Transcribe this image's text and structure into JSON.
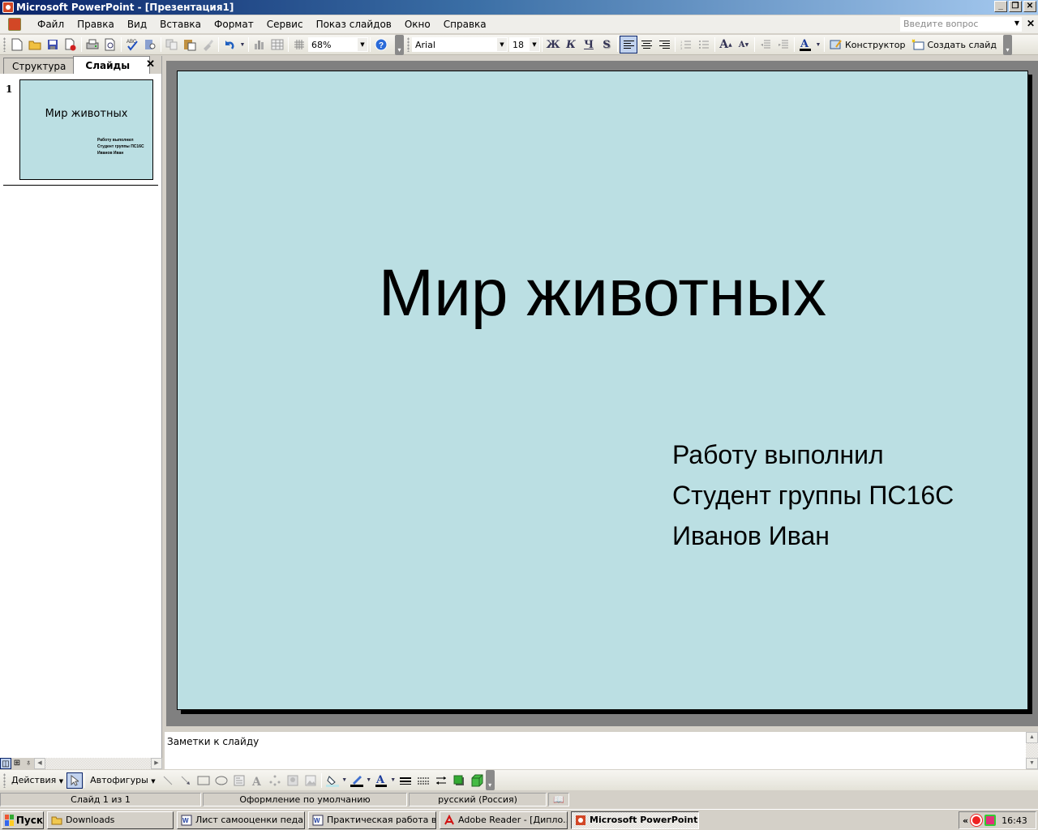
{
  "window": {
    "title": "Microsoft PowerPoint - [Презентация1]",
    "controls": {
      "minimize": "_",
      "restore": "❐",
      "close": "✕"
    }
  },
  "menu": {
    "items": [
      "Файл",
      "Правка",
      "Вид",
      "Вставка",
      "Формат",
      "Сервис",
      "Показ слайдов",
      "Окно",
      "Справка"
    ],
    "help_placeholder": "Введите вопрос",
    "close_label": "✕"
  },
  "toolbar": {
    "zoom": "68%",
    "font": "Arial",
    "font_size": "18",
    "bold": "Ж",
    "italic": "К",
    "underline": "Ч",
    "shadow": "S",
    "designer_label": "Конструктор",
    "new_slide_label": "Создать слайд"
  },
  "left_pane": {
    "tabs": [
      {
        "label": "Структура",
        "active": false
      },
      {
        "label": "Слайды",
        "active": true
      }
    ],
    "close_label": "✕",
    "thumbnails": [
      {
        "number": "1",
        "title": "Мир животных",
        "subtitle": [
          "Работу выполнил",
          "Студент группы ПС16С",
          "Иванов Иван"
        ]
      }
    ]
  },
  "slide": {
    "background": "#bbdfe3",
    "title": "Мир животных",
    "subtitle": [
      "Работу выполнил",
      "Студент группы ПС16С",
      "Иванов Иван"
    ]
  },
  "notes": {
    "placeholder": "Заметки к слайду"
  },
  "draw_toolbar": {
    "actions_label": "Действия",
    "autoshapes_label": "Автофигуры"
  },
  "status": {
    "slide": "Слайд 1 из 1",
    "design": "Оформление по умолчанию",
    "language": "русский (Россия)"
  },
  "taskbar": {
    "start_label": "Пуск",
    "tasks": [
      {
        "label": "Downloads",
        "icon": "folder-icon",
        "active": false
      },
      {
        "label": "Лист самооценки педаг...",
        "icon": "word-icon",
        "active": false
      },
      {
        "label": "Практическая работа в...",
        "icon": "word-icon",
        "active": false
      },
      {
        "label": "Adobe Reader - [Дипло...",
        "icon": "adobe-reader-icon",
        "active": false
      },
      {
        "label": "Microsoft PowerPoint ...",
        "icon": "powerpoint-icon",
        "active": true
      }
    ],
    "tray_expand": "«",
    "clock": "16:43"
  }
}
